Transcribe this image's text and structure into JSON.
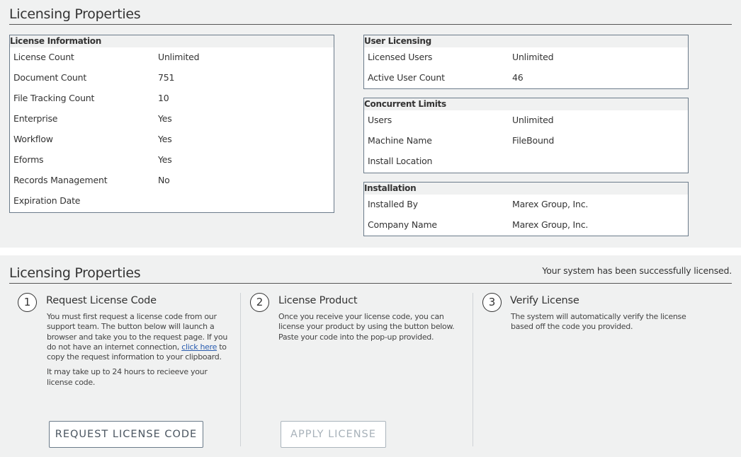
{
  "top": {
    "title": "Licensing Properties",
    "license_info": {
      "heading": "License Information",
      "rows": [
        {
          "label": "License Count",
          "value": "Unlimited"
        },
        {
          "label": "Document Count",
          "value": "751"
        },
        {
          "label": "File Tracking Count",
          "value": "10"
        },
        {
          "label": "Enterprise",
          "value": "Yes"
        },
        {
          "label": "Workflow",
          "value": "Yes"
        },
        {
          "label": "Eforms",
          "value": "Yes"
        },
        {
          "label": "Records Management",
          "value": "No"
        },
        {
          "label": "Expiration Date",
          "value": ""
        }
      ]
    },
    "user_licensing": {
      "heading": "User Licensing",
      "rows": [
        {
          "label": "Licensed Users",
          "value": "Unlimited"
        },
        {
          "label": "Active User Count",
          "value": "46"
        }
      ]
    },
    "concurrent_limits": {
      "heading": "Concurrent Limits",
      "rows": [
        {
          "label": "Users",
          "value": "Unlimited"
        },
        {
          "label": "Machine Name",
          "value": "FileBound"
        },
        {
          "label": "Install Location",
          "value": ""
        }
      ]
    },
    "installation": {
      "heading": "Installation",
      "rows": [
        {
          "label": "Installed By",
          "value": "Marex Group, Inc."
        },
        {
          "label": "Company Name",
          "value": "Marex Group, Inc."
        }
      ]
    }
  },
  "bottom": {
    "title": "Licensing Properties",
    "status": "Your system has been successfully licensed.",
    "steps": [
      {
        "number": "1",
        "title": "Request License Code",
        "text_before_link": "You must first request a license code from our support team. The button below will launch a browser and take you to the request page. If you do not have an internet connection, ",
        "link": "click here",
        "text_after_link": " to copy the request information to your clipboard.",
        "note": "It may take up to 24 hours to recieeve your license code.",
        "button": "REQUEST LICENSE CODE"
      },
      {
        "number": "2",
        "title": "License Product",
        "text": "Once you receive your license code, you can license your product by using the button below. Paste your code into the pop-up provided.",
        "button": "APPLY LICENSE"
      },
      {
        "number": "3",
        "title": "Verify License",
        "text": "The system will automatically verify the license based off the code you provided."
      }
    ]
  }
}
